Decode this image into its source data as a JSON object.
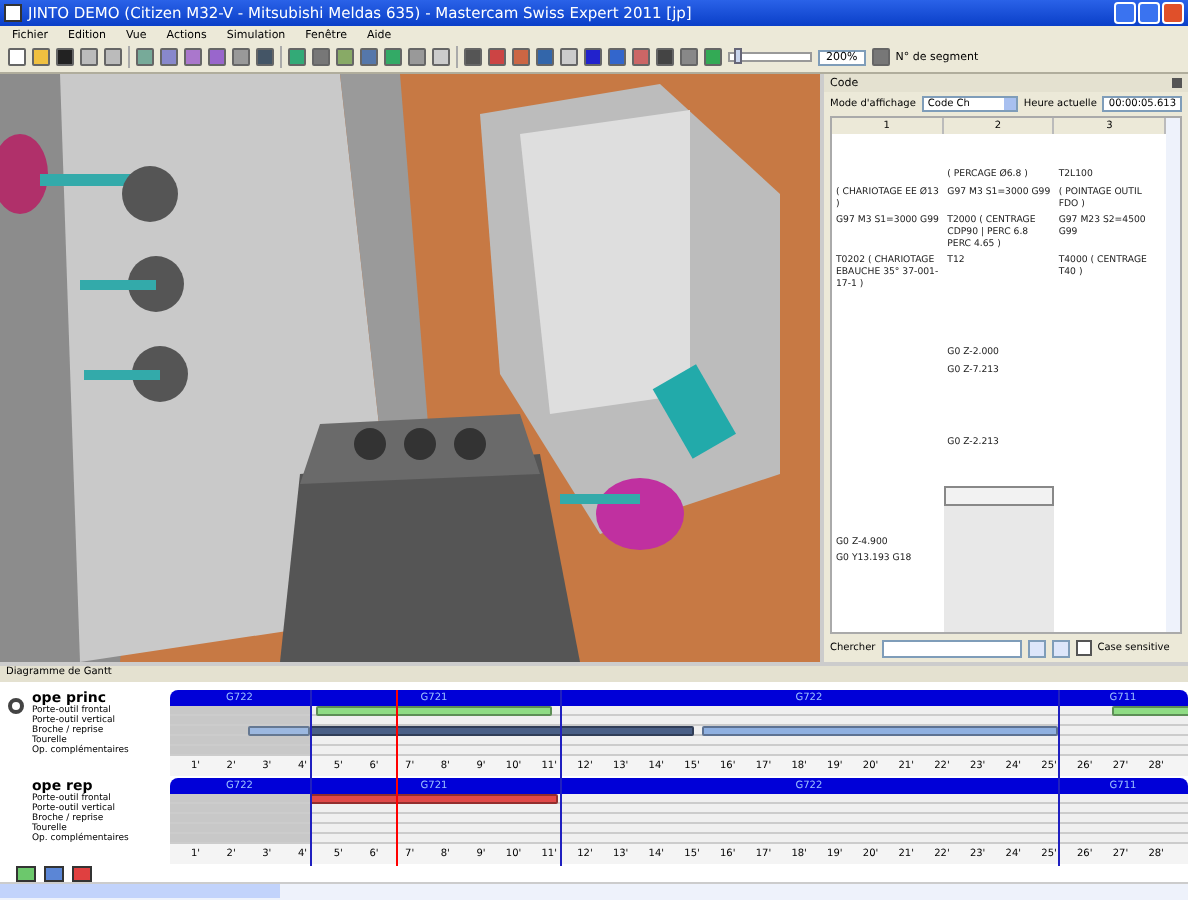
{
  "window": {
    "title": "JINTO DEMO (Citizen M32-V - Mitsubishi Meldas 635) - Mastercam Swiss Expert 2011 [jp]"
  },
  "menu": [
    "Fichier",
    "Edition",
    "Vue",
    "Actions",
    "Simulation",
    "Fenêtre",
    "Aide"
  ],
  "toolbar": {
    "zoom_slider": {
      "level": 0.1
    },
    "zoom": "200%",
    "segment_label": "N° de segment"
  },
  "code_panel": {
    "title": "Code",
    "mode_label": "Mode d'affichage",
    "mode_value": "Code Ch",
    "time_label": "Heure actuelle",
    "time_value": "00:00:05.613",
    "columns": [
      "1",
      "2",
      "3"
    ],
    "rows": [
      {
        "cells": [
          "",
          "( PERCAGE Ø6.8 )",
          "T2L100"
        ],
        "selected": false
      },
      {
        "cells": [
          "( CHARIOTAGE EE Ø13 )",
          "G97 M3 S1=3000 G99",
          "( POINTAGE OUTIL FDO )"
        ],
        "selected": false
      },
      {
        "cells": [
          "G97 M3 S1=3000 G99",
          "T2000 ( CENTRAGE CDP90 | PERC 6.8 PERC 4.65 )",
          "G97 M23 S2=4500 G99"
        ],
        "selected": false
      },
      {
        "cells": [
          "T0202 ( CHARIOTAGE EBAUCHE 35° 37-001-17-1 )",
          "T12",
          "T4000 ( CENTRAGE T40 )"
        ],
        "selected": false
      },
      {
        "cells": [
          "",
          "G0 Z-2.000",
          ""
        ],
        "selected": false
      },
      {
        "cells": [
          "",
          "G0 Z-7.213",
          ""
        ],
        "selected": false
      },
      {
        "cells": [
          "",
          "G0 Z-2.213",
          ""
        ],
        "selected": false
      },
      {
        "cells": [
          "",
          "",
          ""
        ],
        "selected": true
      },
      {
        "cells": [
          "G0 Z-4.900",
          "",
          ""
        ],
        "selected": false
      },
      {
        "cells": [
          "G0 Y13.193 G18",
          "",
          ""
        ],
        "selected": false
      }
    ],
    "search_label": "Chercher",
    "case_label": "Case sensitive",
    "case_checked": false
  },
  "gantt": {
    "title": "Diagramme de Gantt",
    "groups": [
      {
        "name": "ope princ",
        "rows": [
          "Porte-outil frontal",
          "Porte-outil vertical",
          "Broche / reprise",
          "Tourelle",
          "Op. complémentaires"
        ],
        "segments": [
          "G722",
          "G721",
          "G722",
          "G711"
        ],
        "ticks": [
          "1'",
          "2'",
          "3'",
          "4'",
          "5'",
          "6'",
          "7'",
          "8'",
          "9'",
          "10'",
          "11'",
          "12'",
          "13'",
          "14'",
          "15'",
          "16'",
          "17'",
          "18'",
          "19'",
          "20'",
          "21'",
          "22'",
          "23'",
          "24'",
          "25'",
          "26'",
          "27'",
          "28'"
        ]
      },
      {
        "name": "ope rep",
        "rows": [
          "Porte-outil frontal",
          "Porte-outil vertical",
          "Broche / reprise",
          "Tourelle",
          "Op. complémentaires"
        ],
        "segments": [
          "G722",
          "G721",
          "G722",
          "G711"
        ],
        "ticks": [
          "1'",
          "2'",
          "3'",
          "4'",
          "5'",
          "6'",
          "7'",
          "8'",
          "9'",
          "10'",
          "11'",
          "12'",
          "13'",
          "14'",
          "15'",
          "16'",
          "17'",
          "18'",
          "19'",
          "20'",
          "21'",
          "22'",
          "23'",
          "24'",
          "25'",
          "26'",
          "27'",
          "28'"
        ]
      }
    ],
    "bars": [
      {
        "color": "#8fdc84"
      },
      {
        "color": "#8fdc84"
      },
      {
        "color": "#9cb8e0"
      },
      {
        "color": "#4a5f86"
      },
      {
        "color": "#8fb0e0"
      },
      {
        "color": "#e04848"
      }
    ],
    "legend": [
      {
        "color": "#6cc86c"
      },
      {
        "color": "#5b86d6"
      },
      {
        "color": "#e04040"
      }
    ]
  }
}
